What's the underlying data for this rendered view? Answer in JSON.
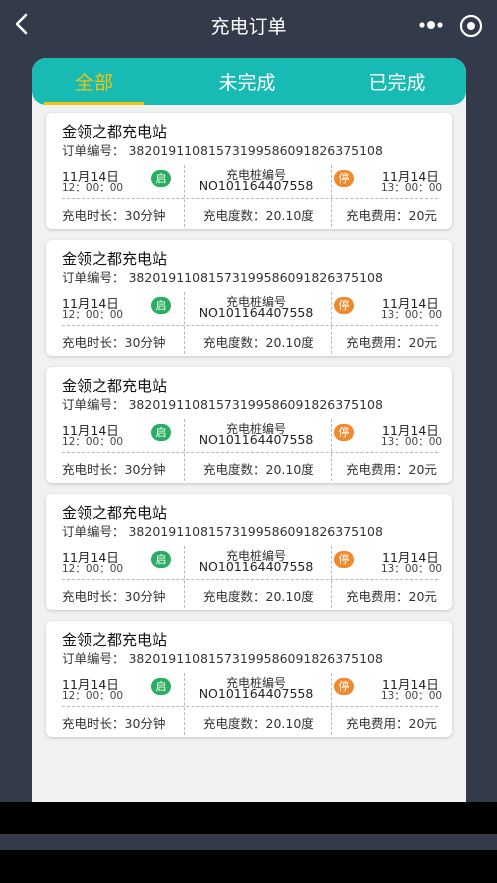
{
  "nav": {
    "title": "充电订单",
    "icons": [
      "back-arrow-icon",
      "more-dots-icon",
      "target-icon"
    ]
  },
  "tabs": [
    {
      "label": "全部",
      "active": true
    },
    {
      "label": "未完成",
      "active": false
    },
    {
      "label": "已完成",
      "active": false
    }
  ],
  "colors": {
    "tab_bar": "#17bbb3",
    "tab_active": "#f1c40f",
    "start_badge": "#27ae60",
    "stop_badge": "#ef8a2e"
  },
  "orders": [
    {
      "station": "金领之都充电站",
      "order_no": "订单编号： 38201911081573199586091826375108",
      "start_date": "11月14日",
      "start_time": "12：00：00",
      "start_badge": "启",
      "pile_label": "充电桩编号",
      "pile_no": "NO101164407558",
      "stop_badge": "停",
      "end_date": "11月14日",
      "end_time": "13：00：00",
      "duration": "充电时长：30分钟",
      "kwh": "充电度数：20.10度",
      "fee": "充电费用：20元"
    },
    {
      "station": "金领之都充电站",
      "order_no": "订单编号： 38201911081573199586091826375108",
      "start_date": "11月14日",
      "start_time": "12：00：00",
      "start_badge": "启",
      "pile_label": "充电桩编号",
      "pile_no": "NO101164407558",
      "stop_badge": "停",
      "end_date": "11月14日",
      "end_time": "13：00：00",
      "duration": "充电时长：30分钟",
      "kwh": "充电度数：20.10度",
      "fee": "充电费用：20元"
    },
    {
      "station": "金领之都充电站",
      "order_no": "订单编号： 38201911081573199586091826375108",
      "start_date": "11月14日",
      "start_time": "12：00：00",
      "start_badge": "启",
      "pile_label": "充电桩编号",
      "pile_no": "NO101164407558",
      "stop_badge": "停",
      "end_date": "11月14日",
      "end_time": "13：00：00",
      "duration": "充电时长：30分钟",
      "kwh": "充电度数：20.10度",
      "fee": "充电费用：20元"
    },
    {
      "station": "金领之都充电站",
      "order_no": "订单编号： 38201911081573199586091826375108",
      "start_date": "11月14日",
      "start_time": "12：00：00",
      "start_badge": "启",
      "pile_label": "充电桩编号",
      "pile_no": "NO101164407558",
      "stop_badge": "停",
      "end_date": "11月14日",
      "end_time": "13：00：00",
      "duration": "充电时长：30分钟",
      "kwh": "充电度数：20.10度",
      "fee": "充电费用：20元"
    },
    {
      "station": "金领之都充电站",
      "order_no": "订单编号： 38201911081573199586091826375108",
      "start_date": "11月14日",
      "start_time": "12：00：00",
      "start_badge": "启",
      "pile_label": "充电桩编号",
      "pile_no": "NO101164407558",
      "stop_badge": "停",
      "end_date": "11月14日",
      "end_time": "13：00：00",
      "duration": "充电时长：30分钟",
      "kwh": "充电度数：20.10度",
      "fee": "充电费用：20元"
    }
  ]
}
